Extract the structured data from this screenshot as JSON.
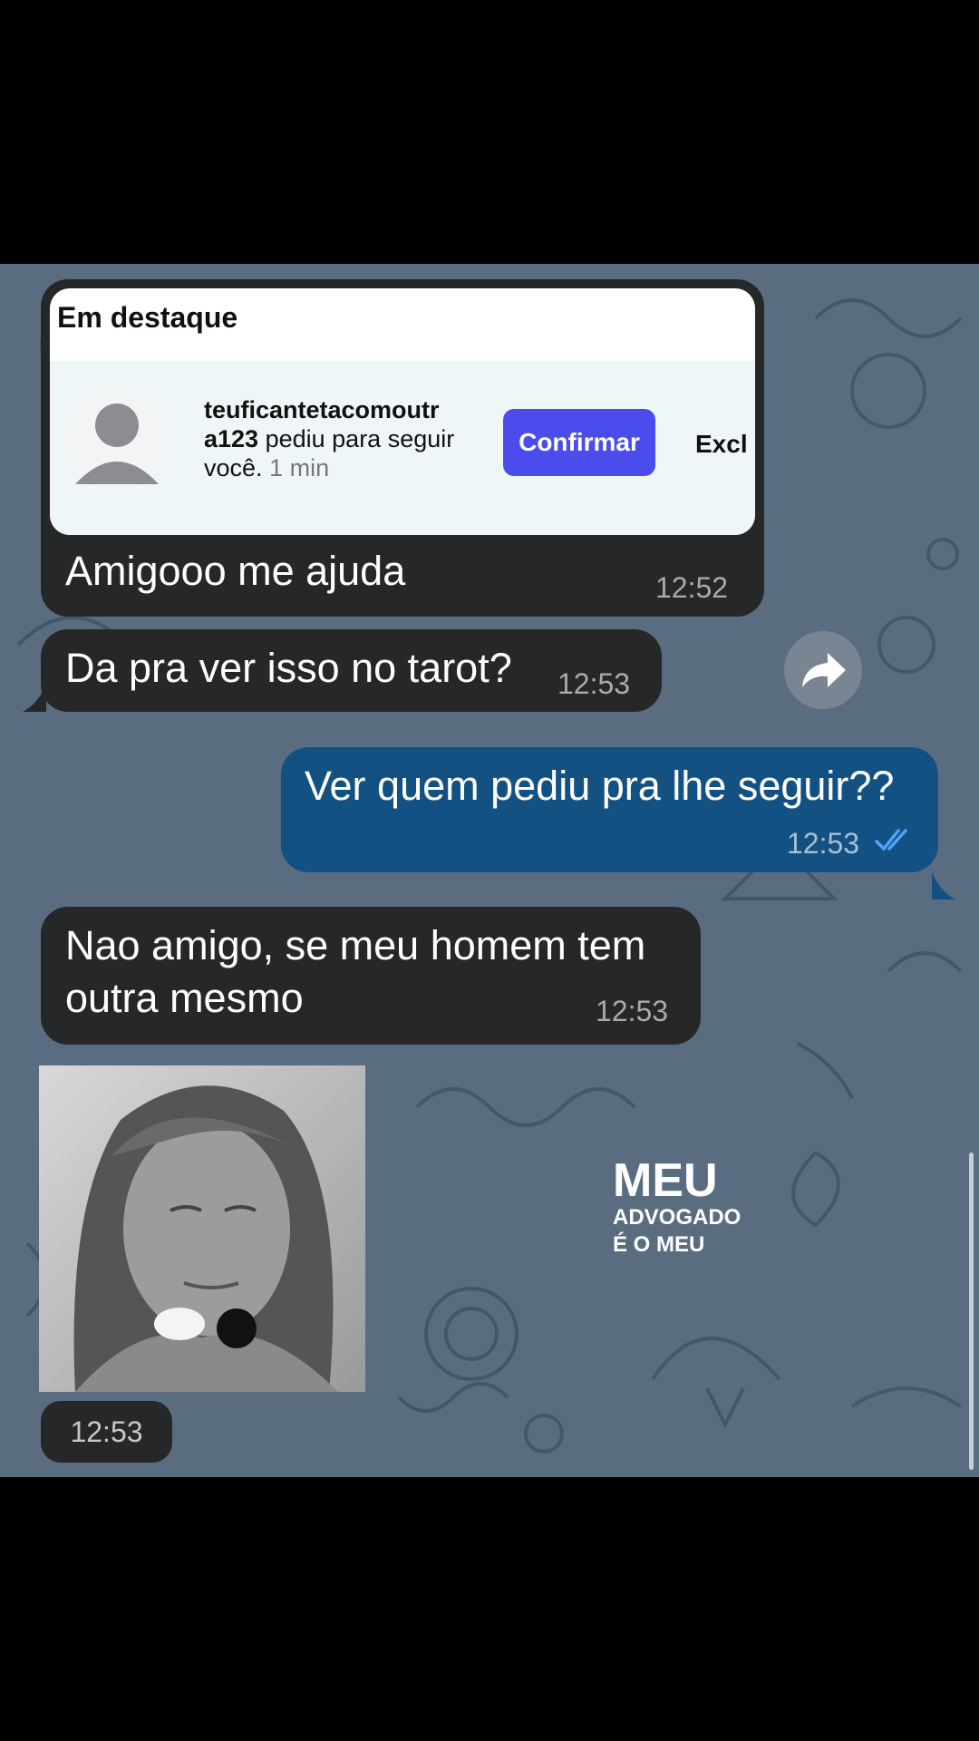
{
  "colors": {
    "chat_background": "#5a6d80",
    "incoming_bubble": "#262728",
    "outgoing_bubble": "#135182",
    "confirm_button": "#4b4cec",
    "read_check": "#4fa3f7"
  },
  "messages": [
    {
      "direction": "incoming",
      "has_media": true,
      "media": {
        "title": "Em destaque",
        "username": "teuficantetacomoutr a123",
        "action_text": "pediu para seguir você.",
        "time": "1 min",
        "confirm_label": "Confirmar",
        "delete_label_partial": "Excl"
      },
      "text": "Amigooo me ajuda",
      "time": "12:52"
    },
    {
      "direction": "incoming",
      "text": "Da pra ver isso no tarot?",
      "time": "12:53"
    },
    {
      "direction": "outgoing",
      "text": "Ver quem pediu pra lhe seguir??",
      "time": "12:53",
      "status": "read-double-check"
    },
    {
      "direction": "incoming",
      "text": "Nao amigo, se meu homem tem\noutra mesmo",
      "time": "12:53"
    },
    {
      "direction": "incoming",
      "type": "photo",
      "emoji_overlay": "🕊️🖤",
      "time": "12:53"
    }
  ],
  "watermark": {
    "line1": "MEU",
    "line2": "ADVOGADO",
    "line3": "É O MEU"
  },
  "icons": {
    "forward": "forward-arrow-icon",
    "read": "double-check-icon"
  }
}
